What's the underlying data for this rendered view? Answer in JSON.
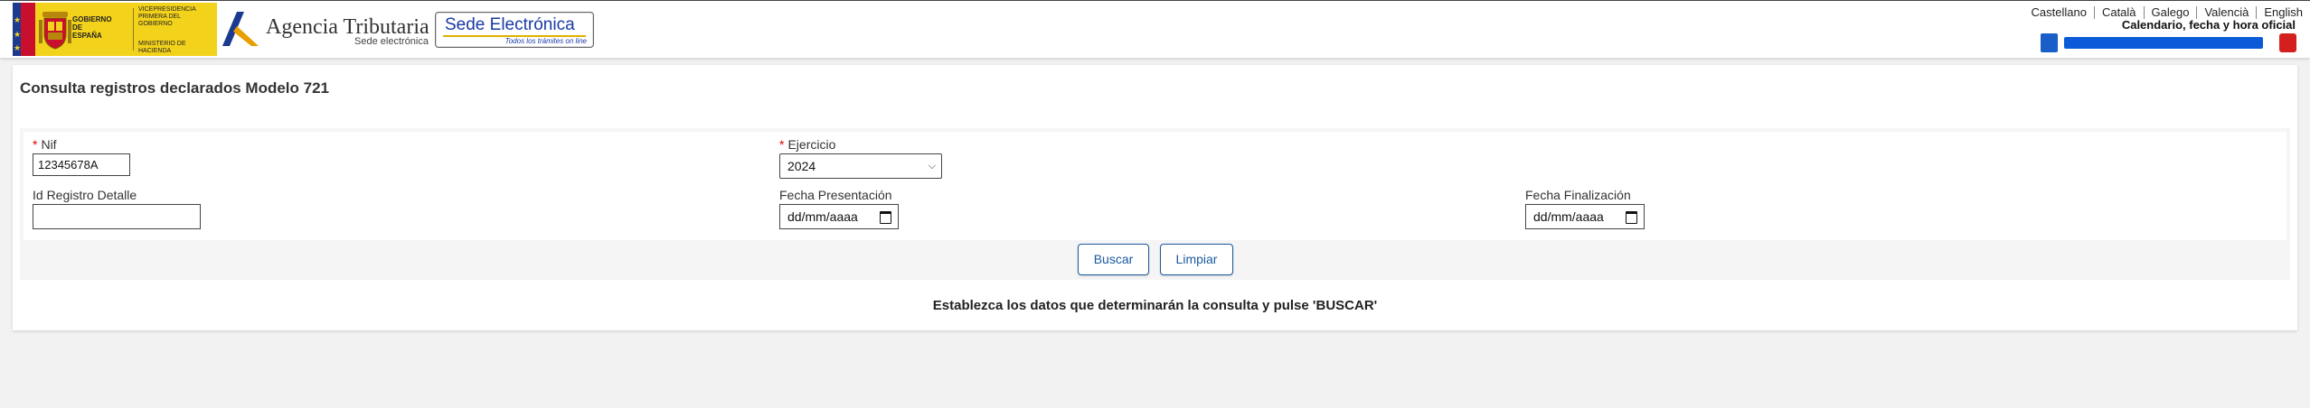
{
  "header": {
    "gov_text": "GOBIERNO DE ESPAÑA",
    "gov_right_top": "VICEPRESIDENCIA PRIMERA DEL GOBIERNO",
    "gov_right_bottom": "MINISTERIO DE HACIENDA",
    "aeat_name": "Agencia Tributaria",
    "aeat_sub": "Sede electrónica",
    "sede_title": "Sede Electrónica",
    "sede_sub": "Todos los trámites on line",
    "languages": [
      "Castellano",
      "Català",
      "Galego",
      "Valencià",
      "English"
    ],
    "calendar_link": "Calendario, fecha y hora oficial",
    "colors": {
      "brand_yellow": "#f3d21b",
      "sede_blue": "#1a3aa6",
      "progress_blue": "#0b5bd8",
      "close_red": "#d41f1f"
    }
  },
  "main": {
    "title": "Consulta registros declarados Modelo 721",
    "fields": {
      "nif": {
        "label": "Nif",
        "value": "12345678A",
        "required": true
      },
      "ejercicio": {
        "label": "Ejercicio",
        "value": "2024",
        "required": true
      },
      "id_registro": {
        "label": "Id Registro Detalle",
        "value": ""
      },
      "fecha_presentacion": {
        "label": "Fecha Presentación",
        "value": "dd/mm/aaaa"
      },
      "fecha_finalizacion": {
        "label": "Fecha Finalización",
        "value": "dd/mm/aaaa"
      }
    },
    "required_mark": "*",
    "buttons": {
      "search": "Buscar",
      "clear": "Limpiar"
    },
    "hint": "Establezca los datos que determinarán la consulta y pulse 'BUSCAR'"
  }
}
